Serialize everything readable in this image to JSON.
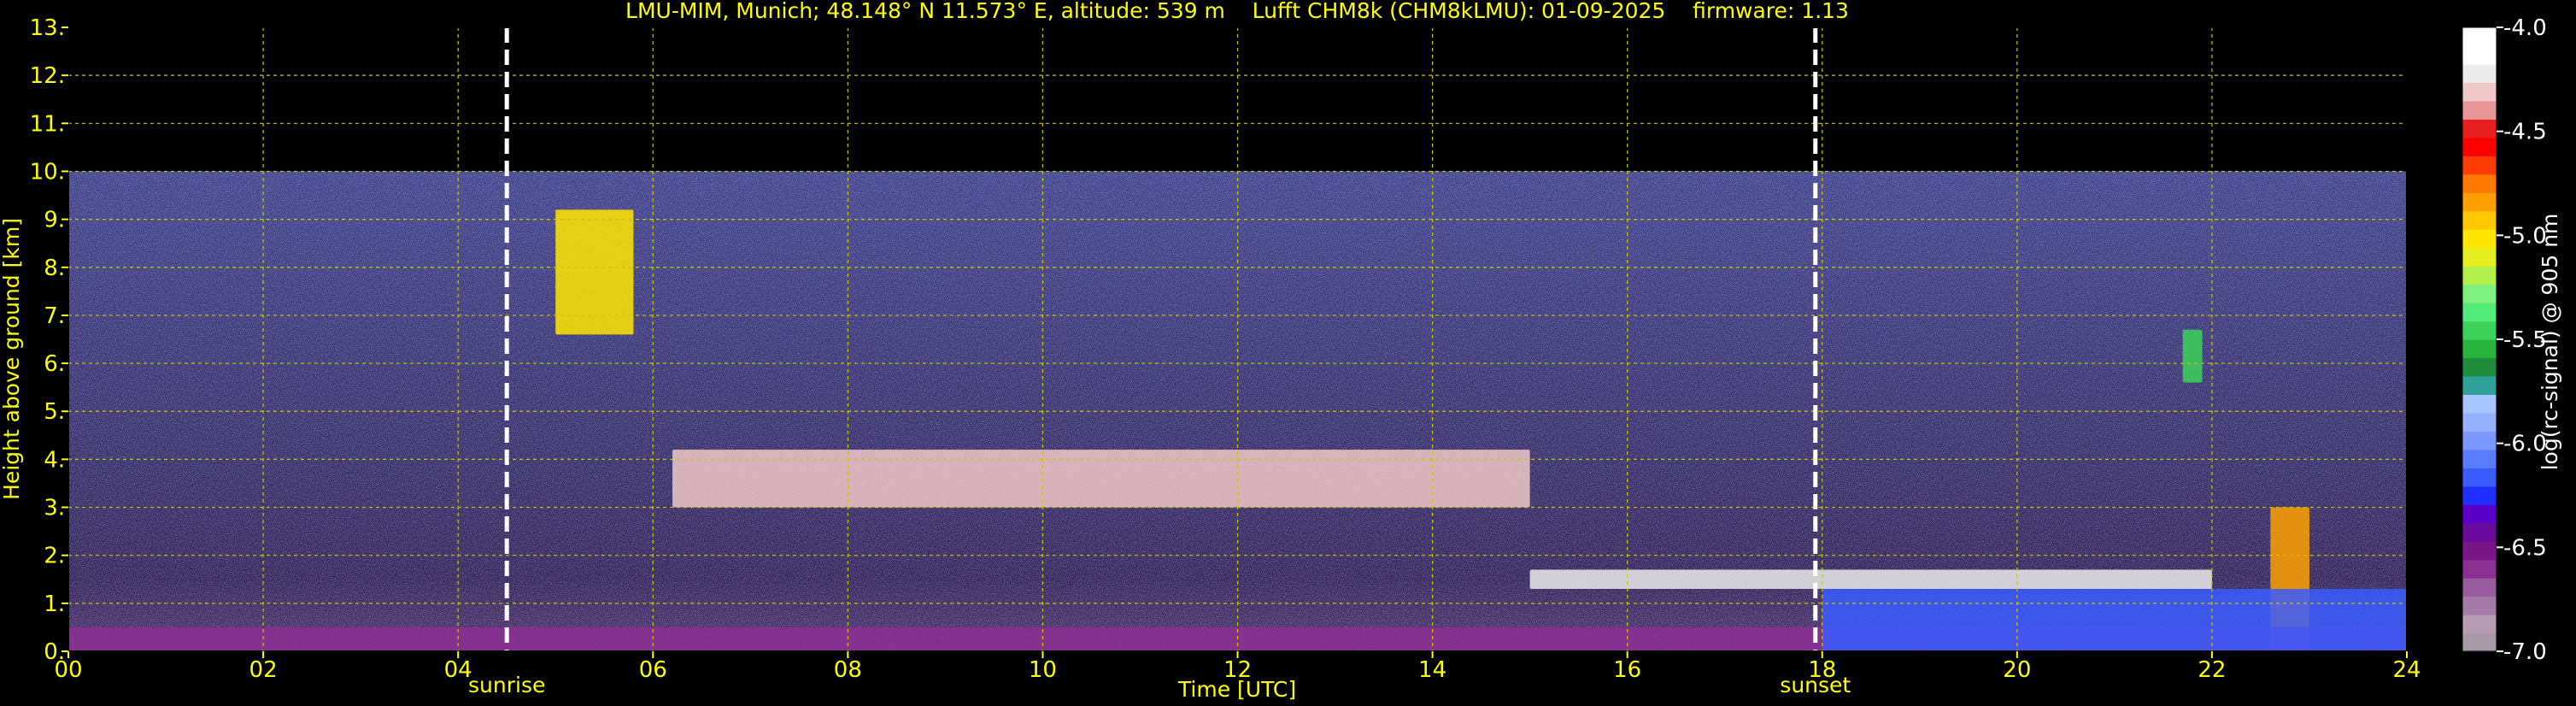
{
  "chart_data": {
    "type": "heatmap",
    "title": "LMU-MIM, Munich; 48.148° N 11.573° E, altitude: 539 m    Lufft CHM8k (CHM8kLMU): 01-09-2025    firmware: 1.13",
    "xlabel": "Time [UTC]",
    "ylabel": "Height above ground [km]",
    "xlim": [
      0,
      24
    ],
    "ylim": [
      0,
      13
    ],
    "x_ticks": [
      "00",
      "02",
      "04",
      "06",
      "08",
      "10",
      "12",
      "14",
      "16",
      "18",
      "20",
      "22",
      "24"
    ],
    "y_ticks": [
      "0.",
      "1.",
      "2.",
      "3.",
      "4.",
      "5.",
      "6.",
      "7.",
      "8.",
      "9.",
      "10.",
      "11.",
      "12.",
      "13."
    ],
    "grid": true,
    "measurement_top_km": 10,
    "markers": [
      {
        "label": "sunrise",
        "x": 4.5
      },
      {
        "label": "sunset",
        "x": 17.93
      }
    ],
    "features": [
      {
        "name": "cirrus-patch",
        "x": [
          5.0,
          5.8
        ],
        "y": [
          6.6,
          9.2
        ],
        "level": -5.0
      },
      {
        "name": "mid-cloud-band",
        "x": [
          6.2,
          15.0
        ],
        "y": [
          3.0,
          4.2
        ],
        "level": -4.3
      },
      {
        "name": "boundary-layer-top",
        "x": [
          15.0,
          22.0
        ],
        "y": [
          1.3,
          1.7
        ],
        "level": -4.2
      },
      {
        "name": "high-cloud-cell",
        "x": [
          21.7,
          21.9
        ],
        "y": [
          5.6,
          6.7
        ],
        "level": -5.5
      },
      {
        "name": "low-cloud-tower",
        "x": [
          22.6,
          23.0
        ],
        "y": [
          0.0,
          3.0
        ],
        "level": -4.8
      },
      {
        "name": "surface-aerosol",
        "x": [
          0.0,
          24.0
        ],
        "y": [
          0.0,
          0.5
        ],
        "level": -6.6
      },
      {
        "name": "evening-mixed-layer",
        "x": [
          18.0,
          24.0
        ],
        "y": [
          0.0,
          1.3
        ],
        "level": -6.2
      }
    ],
    "colorbar": {
      "label": "log(rc-signal) @ 905 nm",
      "min": -7.0,
      "max": -4.0,
      "ticks": [
        "-4.0",
        "-4.5",
        "-5.0",
        "-5.5",
        "-6.0",
        "-6.5",
        "-7.0"
      ],
      "colors": [
        "#a59aa5",
        "#b89bb4",
        "#a47aa6",
        "#9a5a9e",
        "#8c2f93",
        "#7a1688",
        "#6a0a9c",
        "#5a00c8",
        "#1f2fff",
        "#3a5cff",
        "#5a7cff",
        "#7a98ff",
        "#95b0ff",
        "#a8c4ff",
        "#2fa09a",
        "#1e8c3c",
        "#28b43c",
        "#3cd25a",
        "#50eb78",
        "#7df07d",
        "#b4f04b",
        "#e6f01e",
        "#ffe600",
        "#ffc800",
        "#ffa000",
        "#ff7800",
        "#ff3c00",
        "#ff0000",
        "#e61e1e",
        "#e89696",
        "#f0c8c8",
        "#ebebeb",
        "#ffffff",
        "#ffffff"
      ]
    }
  },
  "colors": {
    "text": "#ffff00",
    "grid": "#c8c800",
    "marker": "#ffffff",
    "colorbar_label": "#ffffff",
    "background": "#000000"
  }
}
